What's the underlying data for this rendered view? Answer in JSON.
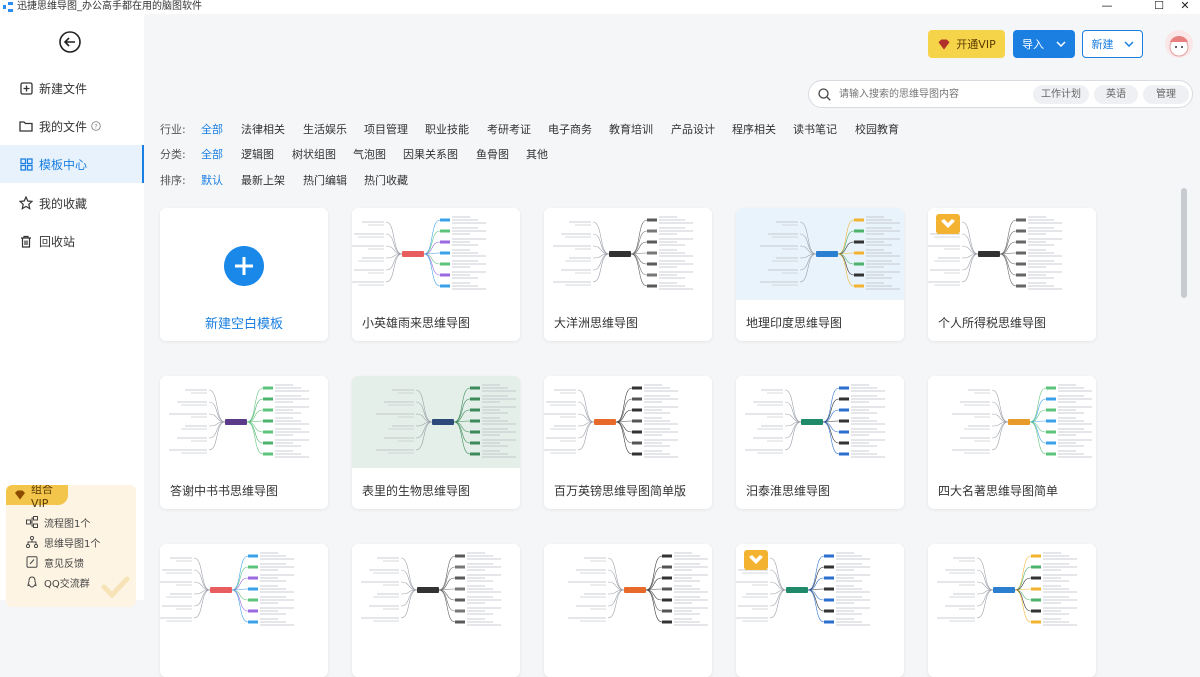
{
  "window": {
    "title": "迅捷思维导图_办公高手都在用的脑图软件",
    "min": "—",
    "max": "☐",
    "close": "✕"
  },
  "sidebar": {
    "items": [
      {
        "label": "新建文件",
        "icon": "add-file-icon"
      },
      {
        "label": "我的文件",
        "icon": "folder-icon"
      },
      {
        "label": "模板中心",
        "icon": "template-grid-icon"
      },
      {
        "label": "我的收藏",
        "icon": "star-icon"
      },
      {
        "label": "回收站",
        "icon": "trash-icon"
      }
    ],
    "vip": {
      "badge": "组合VIP",
      "items": [
        {
          "label": "流程图1个",
          "icon": "flowchart-icon"
        },
        {
          "label": "思维导图1个",
          "icon": "mindmap-icon"
        },
        {
          "label": "意见反馈",
          "icon": "feedback-icon"
        },
        {
          "label": "QQ交流群",
          "icon": "qq-icon"
        }
      ]
    }
  },
  "topbar": {
    "vip_label": "开通VIP",
    "import_label": "导入",
    "new_label": "新建"
  },
  "search": {
    "placeholder": "请输入搜索的思维导图内容",
    "chips": [
      "工作计划",
      "英语",
      "管理"
    ]
  },
  "filters": {
    "industry": {
      "label": "行业:",
      "options": [
        "全部",
        "法律相关",
        "生活娱乐",
        "项目管理",
        "职业技能",
        "考研考证",
        "电子商务",
        "教育培训",
        "产品设计",
        "程序相关",
        "读书笔记",
        "校园教育"
      ],
      "selected": "全部"
    },
    "category": {
      "label": "分类:",
      "options": [
        "全部",
        "逻辑图",
        "树状组图",
        "气泡图",
        "因果关系图",
        "鱼骨图",
        "其他"
      ],
      "selected": "全部"
    },
    "sort": {
      "label": "排序:",
      "options": [
        "默认",
        "最新上架",
        "热门编辑",
        "热门收藏"
      ],
      "selected": "默认"
    }
  },
  "templates": {
    "new_blank": "新建空白模板",
    "cards": [
      {
        "title": "小英雄雨来思维导图"
      },
      {
        "title": "大洋洲思维导图"
      },
      {
        "title": "地理印度思维导图"
      },
      {
        "title": "个人所得税思维导图"
      },
      {
        "title": "答谢中书书思维导图"
      },
      {
        "title": "表里的生物思维导图"
      },
      {
        "title": "百万英镑思维导图简单版"
      },
      {
        "title": "汨泰淮思维导图"
      },
      {
        "title": "四大名著思维导图简单"
      },
      {
        "title": ""
      },
      {
        "title": ""
      },
      {
        "title": ""
      },
      {
        "title": ""
      },
      {
        "title": ""
      }
    ]
  },
  "colors": {
    "accent": "#1a7fe0",
    "vip": "#f6d44a"
  }
}
